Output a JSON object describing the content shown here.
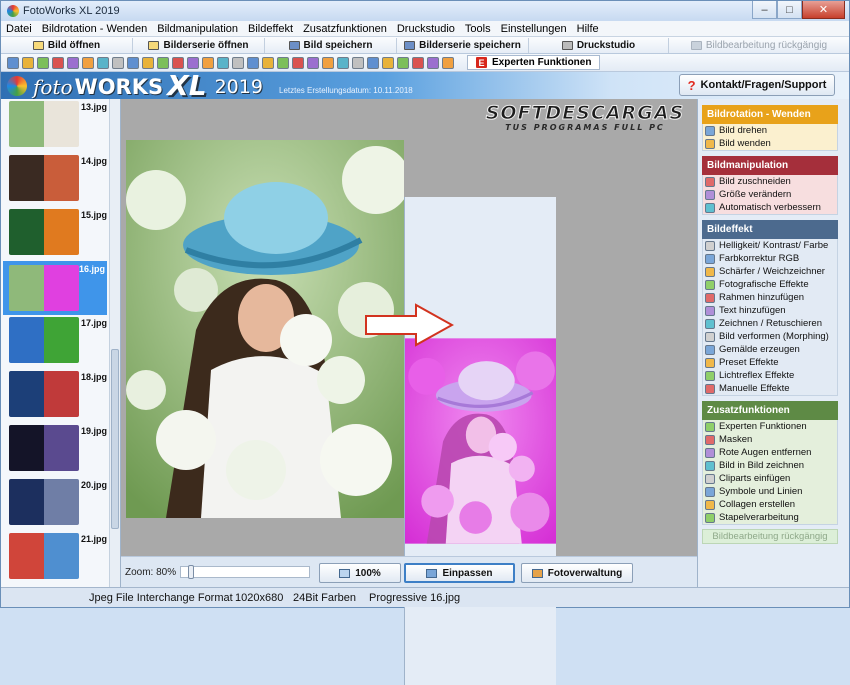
{
  "window": {
    "title": "FotoWorks XL 2019",
    "min": "–",
    "max": "□",
    "close": "✕"
  },
  "menu": [
    "Datei",
    "Bildrotation - Wenden",
    "Bildmanipulation",
    "Bildeffekt",
    "Zusatzfunktionen",
    "Druckstudio",
    "Tools",
    "Einstellungen",
    "Hilfe"
  ],
  "toolbar1": {
    "open": "Bild öffnen",
    "open_series": "Bilderserie öffnen",
    "save": "Bild speichern",
    "save_series": "Bilderserie speichern",
    "print": "Druckstudio",
    "undo": "Bildbearbeitung rückgängig"
  },
  "toolbar2": {
    "expert": "Experten Funktionen",
    "icon_count": 30
  },
  "banner": {
    "logo_foto": "foto",
    "logo_works": "WORKS",
    "logo_xl": "XL",
    "logo_year": "2019",
    "update": "Letztes Erstellungsdatum: 10.11.2018",
    "support": "Kontakt/Fragen/Support"
  },
  "thumbnails": [
    {
      "label": "13.jpg",
      "selected": false,
      "colors": [
        "#8fb97a",
        "#e9e4da"
      ]
    },
    {
      "label": "14.jpg",
      "selected": false,
      "colors": [
        "#3a2a22",
        "#c95d3a"
      ]
    },
    {
      "label": "15.jpg",
      "selected": false,
      "colors": [
        "#1f5f2d",
        "#e07a1f"
      ]
    },
    {
      "label": "16.jpg",
      "selected": true,
      "colors": [
        "#8fb97a",
        "#e040e0"
      ]
    },
    {
      "label": "17.jpg",
      "selected": false,
      "colors": [
        "#2f6fc4",
        "#3fa436"
      ]
    },
    {
      "label": "18.jpg",
      "selected": false,
      "colors": [
        "#1c3f78",
        "#c03a3a"
      ]
    },
    {
      "label": "19.jpg",
      "selected": false,
      "colors": [
        "#141428",
        "#5a4a8f"
      ]
    },
    {
      "label": "20.jpg",
      "selected": false,
      "colors": [
        "#1c2f5e",
        "#6f7ea6"
      ]
    },
    {
      "label": "21.jpg",
      "selected": false,
      "colors": [
        "#d0453a",
        "#4f8fd0"
      ]
    }
  ],
  "watermark": {
    "line1": "SOFTDESCARGAS",
    "line2": "TUS PROGRAMAS FULL PC"
  },
  "bottom": {
    "zoom": "Zoom: 80%",
    "zoom_level": 0.8,
    "btn_100": "100%",
    "btn_fit": "Einpassen",
    "btn_manager": "Fotoverwaltung"
  },
  "sections": [
    {
      "title": "Bildrotation - Wenden",
      "color": "#e8a21a",
      "bg": "#fbf0cf",
      "items": [
        "Bild drehen",
        "Bild wenden"
      ]
    },
    {
      "title": "Bildmanipulation",
      "color": "#a52f3b",
      "bg": "#f7dedf",
      "items": [
        "Bild zuschneiden",
        "Größe verändern",
        "Automatisch verbessern"
      ]
    },
    {
      "title": "Bildeffekt",
      "color": "#4c6a8e",
      "bg": "#e2eaf4",
      "items": [
        "Helligkeit/ Kontrast/ Farbe",
        "Farbkorrektur RGB",
        "Schärfer / Weichzeichner",
        "Fotografische Effekte",
        "Rahmen hinzufügen",
        "Text hinzufügen",
        "Zeichnen / Retuschieren",
        "Bild verformen (Morphing)",
        "Gemälde erzeugen",
        "Preset Effekte",
        "Lichtreflex Effekte",
        "Manuelle Effekte"
      ]
    },
    {
      "title": "Zusatzfunktionen",
      "color": "#5e8a45",
      "bg": "#e4efdc",
      "items": [
        "Experten Funktionen",
        "Masken",
        "Rote Augen entfernen",
        "Bild in Bild zeichnen",
        "Cliparts einfügen",
        "Symbole und Linien",
        "Collagen erstellen",
        "Stapelverarbeitung"
      ]
    }
  ],
  "undo_right": "Bildbearbeitung rückgängig",
  "status": {
    "format": "Jpeg File Interchange Format",
    "dims": "1020x680",
    "colors": "24Bit Farben",
    "file": "Progressive 16.jpg"
  }
}
